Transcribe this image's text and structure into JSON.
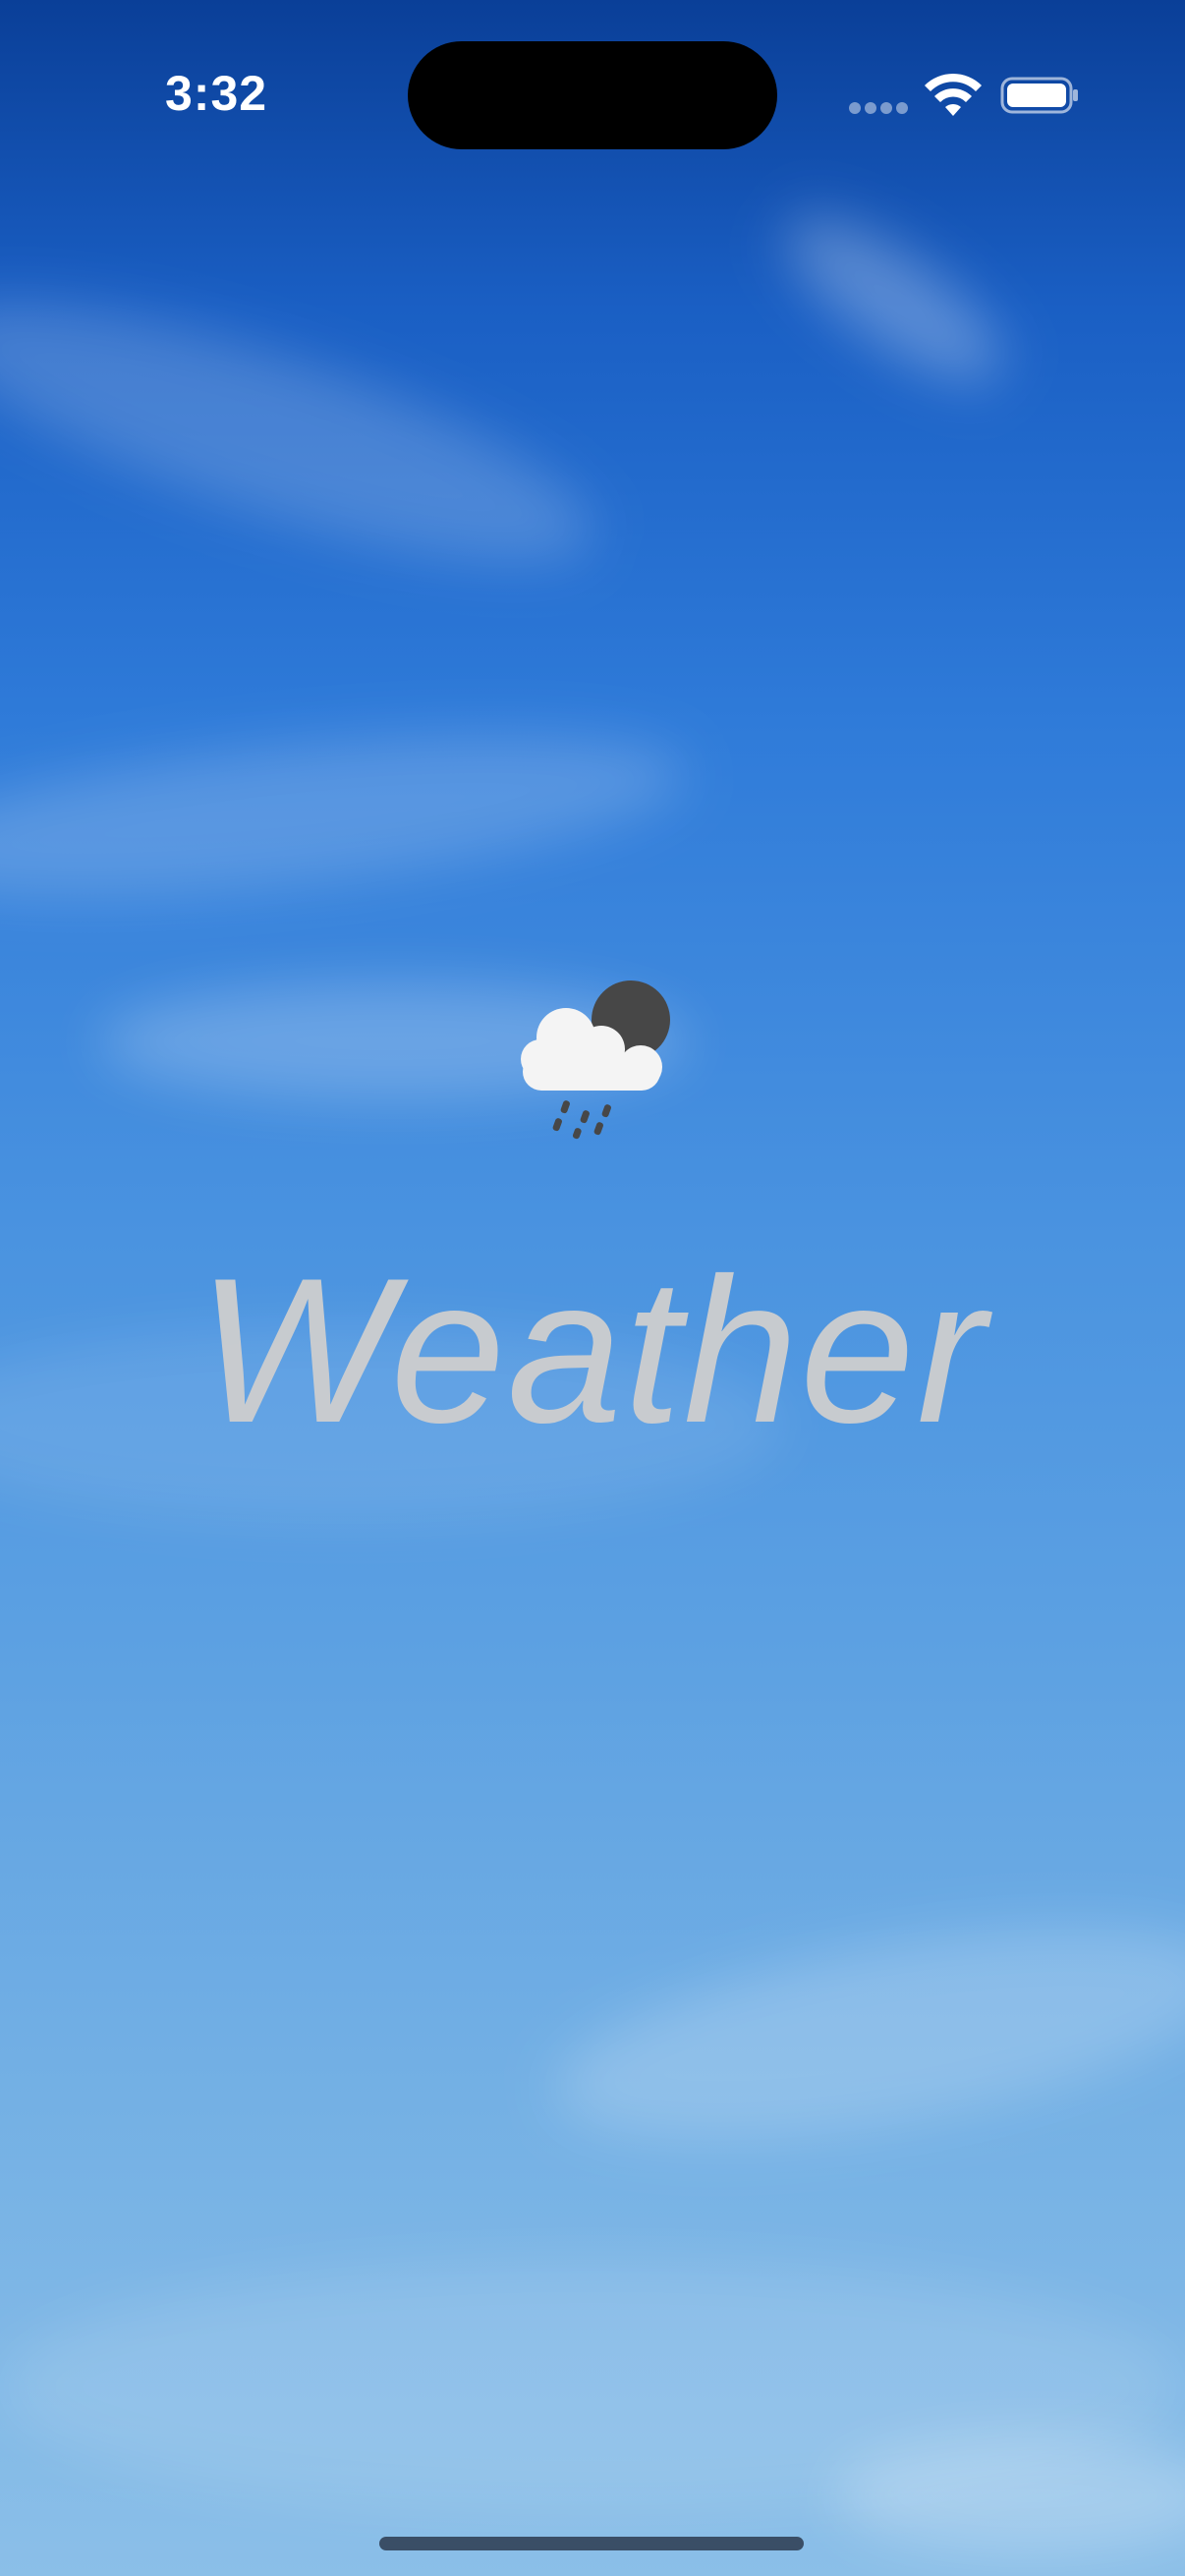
{
  "status_bar": {
    "time": "3:32",
    "wifi_icon": "wifi-icon",
    "battery_icon": "battery-icon"
  },
  "splash": {
    "icon": "cloud-rain-moon-icon",
    "title": "Weather"
  },
  "colors": {
    "background_top": "#0a3f98",
    "background_bottom": "#8bbfe8",
    "title": "#cdcdcd"
  }
}
